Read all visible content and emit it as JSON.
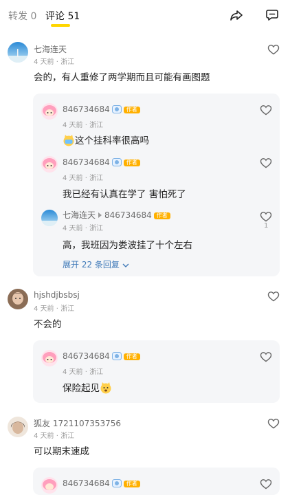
{
  "header": {
    "repost_label": "转发",
    "repost_count": "0",
    "comments_label": "评论",
    "comments_count": "51"
  },
  "comments": [
    {
      "user": "七海连天",
      "meta": "4 天前 · 浙江",
      "text": "会的，有人重修了两学期而且可能有画图题",
      "replies": [
        {
          "user": "846734684",
          "badge": "作者",
          "meta": "4 天前 · 浙江",
          "text": "这个挂科率很高吗"
        },
        {
          "user": "846734684",
          "badge": "作者",
          "meta": "4 天前 · 浙江",
          "text": "我已经有认真在学了 害怕死了"
        },
        {
          "user": "七海连天",
          "reply_to": "846734684",
          "badge": "作者",
          "meta": "4 天前 · 浙江",
          "text": "高，我班因为娄波挂了十个左右",
          "likes": "1"
        }
      ],
      "expand": "展开 22 条回复"
    },
    {
      "user": "hjshdjbsbsj",
      "meta": "4 天前 · 浙江",
      "text": "不会的",
      "replies": [
        {
          "user": "846734684",
          "badge": "作者",
          "meta": "4 天前 · 浙江",
          "text": "保险起见"
        }
      ]
    },
    {
      "user": "狐友 1721107353756",
      "meta": "4 天前 · 浙江",
      "text": "可以期末速成",
      "replies": [
        {
          "user": "846734684",
          "badge": "作者"
        }
      ]
    }
  ],
  "colors": {
    "accent_yellow": "#ffd600",
    "author_badge": "#ffb000",
    "link_blue": "#3f79b8"
  }
}
